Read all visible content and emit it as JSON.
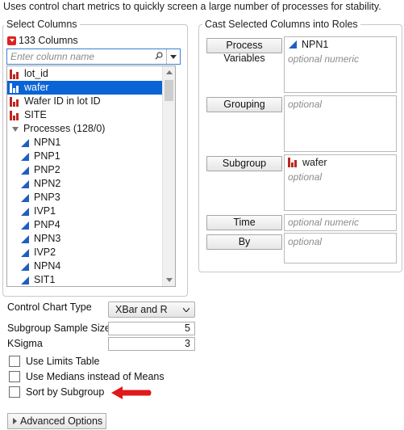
{
  "description": "Uses control chart metrics to quickly screen a large number of processes for stability.",
  "select_columns": {
    "title": "Select Columns",
    "count_label": "133 Columns",
    "search_placeholder": "Enter column name",
    "items": [
      {
        "label": "lot_id",
        "icon": "nominal-bar-icon",
        "selected": false
      },
      {
        "label": "wafer",
        "icon": "nominal-bar-icon",
        "selected": true
      },
      {
        "label": "Wafer ID in lot ID",
        "icon": "nominal-bar-icon",
        "selected": false
      },
      {
        "label": "SITE",
        "icon": "nominal-bar-icon",
        "selected": false
      },
      {
        "label": "Processes (128/0)",
        "icon": "expand-triangle-icon",
        "selected": false
      },
      {
        "label": "NPN1",
        "icon": "continuous-triangle-icon",
        "selected": false
      },
      {
        "label": "PNP1",
        "icon": "continuous-triangle-icon",
        "selected": false
      },
      {
        "label": "PNP2",
        "icon": "continuous-triangle-icon",
        "selected": false
      },
      {
        "label": "NPN2",
        "icon": "continuous-triangle-icon",
        "selected": false
      },
      {
        "label": "PNP3",
        "icon": "continuous-triangle-icon",
        "selected": false
      },
      {
        "label": "IVP1",
        "icon": "continuous-triangle-icon",
        "selected": false
      },
      {
        "label": "PNP4",
        "icon": "continuous-triangle-icon",
        "selected": false
      },
      {
        "label": "NPN3",
        "icon": "continuous-triangle-icon",
        "selected": false
      },
      {
        "label": "IVP2",
        "icon": "continuous-triangle-icon",
        "selected": false
      },
      {
        "label": "NPN4",
        "icon": "continuous-triangle-icon",
        "selected": false
      },
      {
        "label": "SIT1",
        "icon": "continuous-triangle-icon",
        "selected": false
      }
    ]
  },
  "roles": {
    "title": "Cast Selected Columns into Roles",
    "process_variables": {
      "label": "Process Variables",
      "value": "NPN1",
      "hint": "optional numeric"
    },
    "grouping": {
      "label": "Grouping",
      "hint": "optional"
    },
    "subgroup": {
      "label": "Subgroup",
      "value": "wafer",
      "hint": "optional"
    },
    "time": {
      "label": "Time",
      "hint": "optional numeric"
    },
    "by": {
      "label": "By",
      "hint": "optional"
    }
  },
  "options": {
    "control_chart_type_label": "Control Chart Type",
    "control_chart_type_value": "XBar and R",
    "subgroup_sample_size_label": "Subgroup Sample Size",
    "subgroup_sample_size_value": "5",
    "ksigma_label": "KSigma",
    "ksigma_value": "3",
    "checkboxes": [
      {
        "label": "Use Limits Table",
        "checked": false
      },
      {
        "label": "Use Medians instead of Means",
        "checked": false
      },
      {
        "label": "Sort by Subgroup",
        "checked": false
      }
    ],
    "advanced_options_label": "Advanced Options"
  },
  "colors": {
    "selection": "#0a64d6",
    "nominal_icon": "#c0251e",
    "continuous_icon": "#1f5fbf",
    "annotation_arrow": "#e0191b"
  }
}
